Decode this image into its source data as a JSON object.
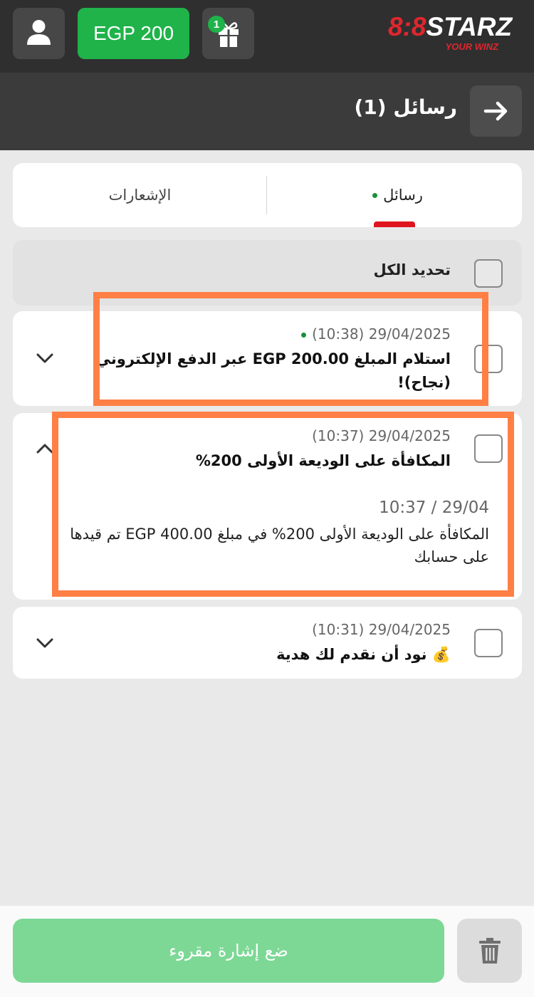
{
  "topbar": {
    "balance": "EGP 200",
    "gift_badge_count": "1",
    "logo_text_red": "8:8",
    "logo_text_white": "STARZ",
    "logo_tagline": "YOUR WINZ",
    "icons": {
      "profile": "user-icon",
      "gift": "gift-icon"
    }
  },
  "header": {
    "title": "رسائل (1)",
    "back_icon": "arrow-right-icon"
  },
  "tabs": [
    {
      "label": "رسائل",
      "active": true,
      "unread_dot": true
    },
    {
      "label": "الإشعارات",
      "active": false
    }
  ],
  "select_all": {
    "label": "تحديد الكل",
    "checked": false
  },
  "messages": [
    {
      "date": "29/04/2025 (10:38)",
      "unread": true,
      "title": "استلام المبلغ EGP 200.00 عبر الدفع الإلكتروني (نجاح)!",
      "expanded": false,
      "checked": false
    },
    {
      "date": "29/04/2025 (10:37)",
      "unread": false,
      "title": "المكافأة على الوديعة الأولى 200%",
      "expanded": true,
      "checked": false,
      "body_date": "10:37 / 29/04",
      "body": "المكافأة على الوديعة الأولى 200% في مبلغ EGP 400.00 تم قيدها على حسابك"
    },
    {
      "date": "29/04/2025 (10:31)",
      "unread": false,
      "title": "💰 نود أن نقدم لك هدية",
      "expanded": false,
      "checked": false
    }
  ],
  "bottombar": {
    "mark_read_label": "ضع إشارة مقروء",
    "delete_icon": "trash-icon"
  },
  "colors": {
    "topbar_bg": "#2f2f2f",
    "header_bg": "#3b3b3b",
    "accent_green": "#1fb34a",
    "accent_red": "#e0141e",
    "highlight_orange": "#ff7f45"
  }
}
